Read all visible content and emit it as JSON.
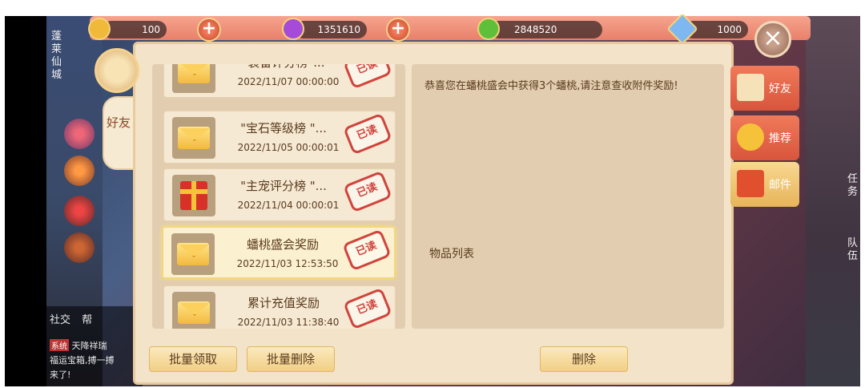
{
  "resources": [
    {
      "name": "gold",
      "value": "100",
      "color": "#f0b93a"
    },
    {
      "name": "purple-gem",
      "value": "1351610",
      "color": "#a64ad9"
    },
    {
      "name": "green-gem",
      "value": "2848520",
      "color": "#5fbf3a"
    },
    {
      "name": "diamond",
      "value": "1000",
      "color": "#7fb8f0"
    }
  ],
  "left_tab": {
    "label": "好友"
  },
  "mail_list": [
    {
      "title": "\"装备评分榜\"...",
      "date": "2022/11/07 00:00:00",
      "icon": "envelope-icon",
      "stamp": "已读",
      "selected": false
    },
    {
      "title": "\"宝石等级榜 \"...",
      "date": "2022/11/05 00:00:01",
      "icon": "envelope-icon",
      "stamp": "已读",
      "selected": false
    },
    {
      "title": "\"主宠评分榜 \"...",
      "date": "2022/11/04 00:00:01",
      "icon": "gift-icon",
      "stamp": "已读",
      "selected": false
    },
    {
      "title": "蟠桃盛会奖励",
      "date": "2022/11/03 12:53:50",
      "icon": "envelope-icon",
      "stamp": "已读",
      "selected": true
    },
    {
      "title": "累计充值奖励",
      "date": "2022/11/03 11:38:40",
      "icon": "envelope-icon",
      "stamp": "已读",
      "selected": false
    }
  ],
  "detail": {
    "message": "恭喜您在蟠桃盛会中获得3个蟠桃,请注意查收附件奖励!",
    "items_label": "物品列表"
  },
  "buttons": {
    "batch_claim": "批量领取",
    "batch_delete": "批量删除",
    "delete": "删除"
  },
  "right_tabs": [
    {
      "label": "好友",
      "icon": "scroll-icon"
    },
    {
      "label": "推荐",
      "icon": "recommend-icon"
    },
    {
      "label": "邮件",
      "icon": "mail-tab-icon",
      "active": true
    }
  ],
  "chat": {
    "tag": "系统",
    "line1": "天降祥瑞",
    "social_label": "社交",
    "help_label": "帮",
    "line2": "福运宝箱,搏一搏",
    "line3": "来了!"
  },
  "side_labels": {
    "city": "蓬莱仙城",
    "task": "任务",
    "team": "队伍"
  }
}
